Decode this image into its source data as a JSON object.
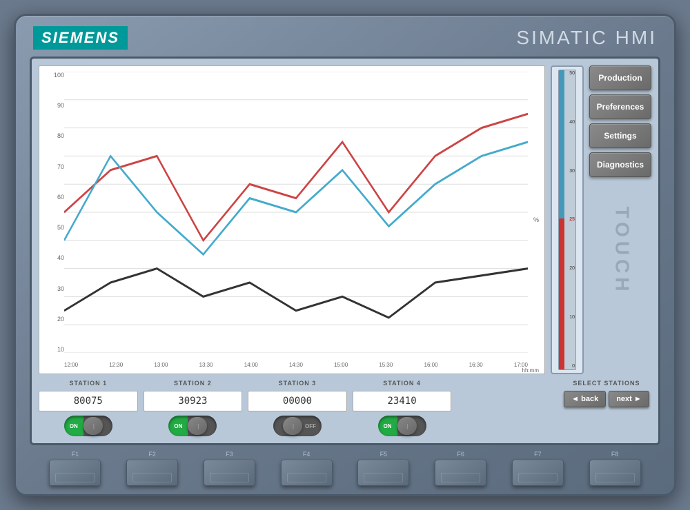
{
  "device": {
    "brand": "SIEMENS",
    "title": "SIMATIC HMI",
    "touch_label": "TOUCH"
  },
  "nav_buttons": [
    {
      "id": "production",
      "label": "Production"
    },
    {
      "id": "preferences",
      "label": "Preferences"
    },
    {
      "id": "settings",
      "label": "Settings"
    },
    {
      "id": "diagnostics",
      "label": "Diagnostics"
    }
  ],
  "chart": {
    "y_labels": [
      "100",
      "90",
      "80",
      "70",
      "60",
      "50",
      "40",
      "30",
      "20",
      "10"
    ],
    "x_labels": [
      "12:00",
      "12:30",
      "13:00",
      "13:30",
      "14:00",
      "14:30",
      "15:00",
      "15:30",
      "16:00",
      "16:30",
      "17:00"
    ],
    "x_unit": "hh:mm",
    "percent_label": "%"
  },
  "gauge": {
    "labels": [
      "50",
      "40",
      "30",
      "25",
      "20",
      "10",
      "0"
    ],
    "value": 25,
    "max": 50
  },
  "stations": [
    {
      "id": "station1",
      "label": "STATION 1",
      "value": "80075",
      "state": "on"
    },
    {
      "id": "station2",
      "label": "STATION 2",
      "value": "30923",
      "state": "on"
    },
    {
      "id": "station3",
      "label": "STATION 3",
      "value": "00000",
      "state": "off"
    },
    {
      "id": "station4",
      "label": "STATION 4",
      "value": "23410",
      "state": "on"
    }
  ],
  "select_stations": {
    "label": "SELECT STATIONS",
    "back_label": "◄ back",
    "next_label": "next ►"
  },
  "function_keys": [
    "F1",
    "F2",
    "F3",
    "F4",
    "F5",
    "F6",
    "F7",
    "F8"
  ]
}
